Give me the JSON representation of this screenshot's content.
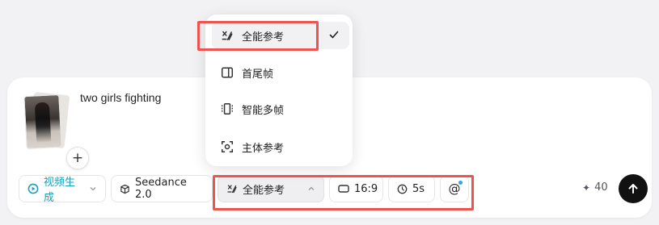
{
  "prompt": {
    "text": "two girls fighting",
    "add_label": "+"
  },
  "toolbar": {
    "generate_label": "视频生成",
    "model_label": "Seedance 2.0",
    "reference_label": "全能参考",
    "ratio_label": "16:9",
    "duration_label": "5s",
    "mention_label": "@",
    "credits": "40",
    "accent_color": "#1aa0b8"
  },
  "menu": {
    "items": [
      {
        "label": "全能参考",
        "icon": "omni-reference-icon",
        "selected": true
      },
      {
        "label": "首尾帧",
        "icon": "first-last-frame-icon",
        "selected": false
      },
      {
        "label": "智能多帧",
        "icon": "smart-multi-frame-icon",
        "selected": false
      },
      {
        "label": "主体参考",
        "icon": "subject-reference-icon",
        "selected": false
      }
    ]
  },
  "annotation_color": "#ef5350"
}
